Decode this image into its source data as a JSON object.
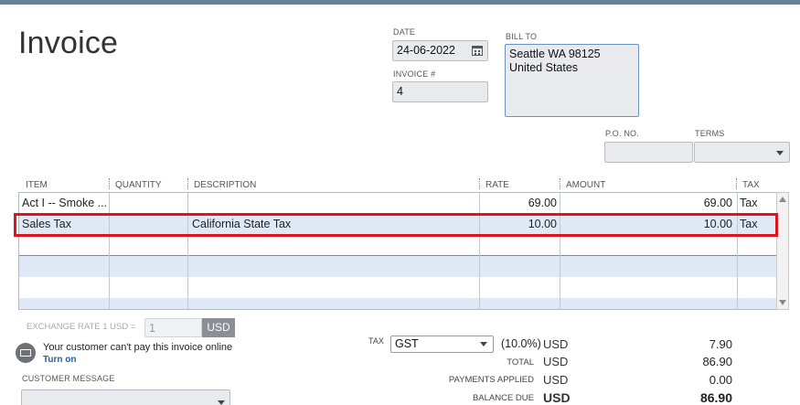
{
  "title": "Invoice",
  "date": {
    "label": "DATE",
    "value": "24-06-2022"
  },
  "invoice_no": {
    "label": "INVOICE #",
    "value": "4"
  },
  "bill_to": {
    "label": "BILL TO",
    "line1": "Seattle WA 98125",
    "line2": "United States"
  },
  "po_no": {
    "label": "P.O. NO.",
    "value": ""
  },
  "terms": {
    "label": "TERMS",
    "value": ""
  },
  "columns": {
    "item": "ITEM",
    "quantity": "QUANTITY",
    "description": "DESCRIPTION",
    "rate": "RATE",
    "amount": "AMOUNT",
    "tax": "TAX"
  },
  "rows": [
    {
      "item": "Act I -- Smoke ...",
      "quantity": "",
      "description": "",
      "rate": "69.00",
      "amount": "69.00",
      "tax": "Tax"
    },
    {
      "item": "Sales Tax",
      "quantity": "",
      "description": "California State Tax",
      "rate": "10.00",
      "amount": "10.00",
      "tax": "Tax"
    }
  ],
  "exchange": {
    "label": "EXCHANGE RATE 1 USD =",
    "value": "1",
    "currency": "USD"
  },
  "online_payment": {
    "message": "Your customer can't pay this invoice online",
    "link": "Turn on"
  },
  "customer_message": {
    "label": "CUSTOMER MESSAGE",
    "value": ""
  },
  "tax": {
    "label": "TAX",
    "code": "GST",
    "percent": "(10.0%)",
    "currency": "USD",
    "value": "7.90"
  },
  "total": {
    "label": "TOTAL",
    "currency": "USD",
    "value": "86.90"
  },
  "payments_applied": {
    "label": "PAYMENTS APPLIED",
    "currency": "USD",
    "value": "0.00"
  },
  "balance_due": {
    "label": "BALANCE DUE",
    "currency": "USD",
    "value": "86.90"
  },
  "colors": {
    "highlight": "#e0141f",
    "alt_row": "#dfe8f5",
    "top_bar": "#6a7f99",
    "link": "#1f5fa8"
  }
}
